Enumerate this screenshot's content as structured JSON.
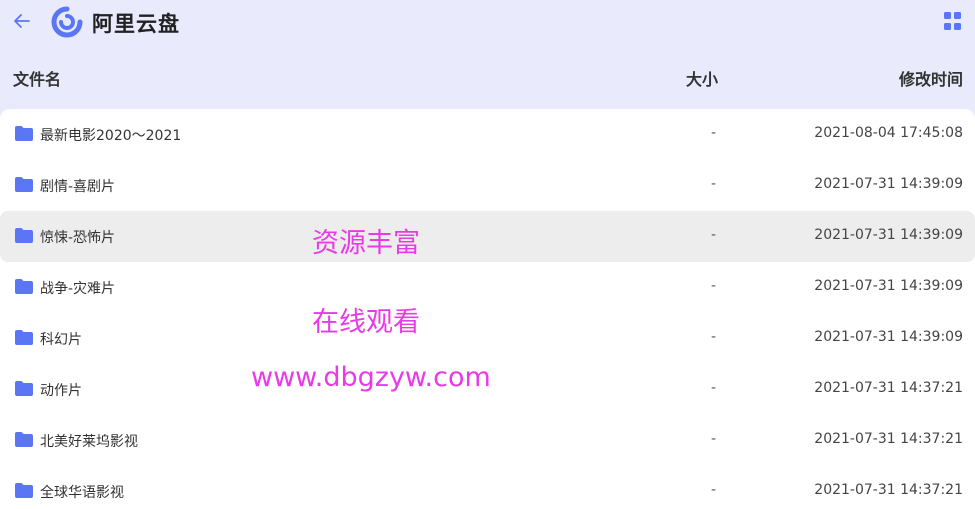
{
  "header": {
    "title": "阿里云盘"
  },
  "columns": {
    "name": "文件名",
    "size": "大小",
    "time": "修改时间"
  },
  "files": [
    {
      "name": "最新电影2020～2021",
      "size": "-",
      "time": "2021-08-04 17:45:08"
    },
    {
      "name": "剧情-喜剧片",
      "size": "-",
      "time": "2021-07-31 14:39:09"
    },
    {
      "name": "惊悚-恐怖片",
      "size": "-",
      "time": "2021-07-31 14:39:09"
    },
    {
      "name": "战争-灾难片",
      "size": "-",
      "time": "2021-07-31 14:39:09"
    },
    {
      "name": "科幻片",
      "size": "-",
      "time": "2021-07-31 14:39:09"
    },
    {
      "name": "动作片",
      "size": "-",
      "time": "2021-07-31 14:37:21"
    },
    {
      "name": "北美好莱坞影视",
      "size": "-",
      "time": "2021-07-31 14:37:21"
    },
    {
      "name": "全球华语影视",
      "size": "-",
      "time": "2021-07-31 14:37:21"
    }
  ],
  "overlay": {
    "line1": "资源丰富",
    "line2": "在线观看",
    "line3": "www.dbgzyw.com"
  },
  "colors": {
    "accent": "#5b76f5",
    "header_bg": "#e9ebfd",
    "overlay_text": "#e83ae8"
  },
  "icons": {
    "back": "arrow-left-icon",
    "logo": "aliyun-drive-logo",
    "view_toggle": "grid-view-icon",
    "folder": "folder-icon"
  }
}
